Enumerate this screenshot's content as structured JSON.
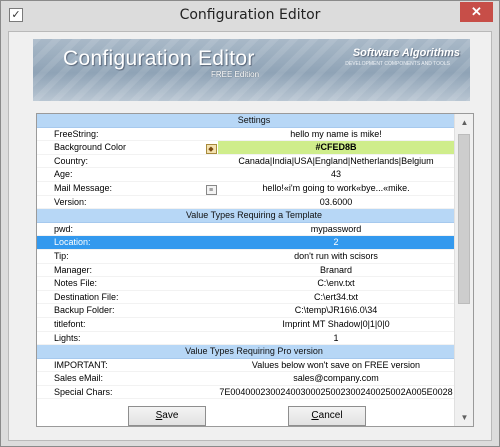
{
  "window": {
    "title": "Configuration Editor",
    "close_glyph": "✕",
    "app_icon": "check-icon"
  },
  "banner": {
    "title": "Configuration Editor",
    "edition": "FREE Edition",
    "brand": "Software Algorithms",
    "tagline": "DEVELOPMENT COMPONENTS AND TOOLS"
  },
  "grid": {
    "rows": [
      {
        "type": "header",
        "label": "Settings"
      },
      {
        "type": "item",
        "key": "FreeString:",
        "value": "hello my name is mike!"
      },
      {
        "type": "item",
        "key": "Background Color",
        "value": "#CFED8B",
        "button": "palette-icon",
        "color": "#cfed8b"
      },
      {
        "type": "item",
        "key": "Country:",
        "value": "Canada|India|USA|England|Netherlands|Belgium"
      },
      {
        "type": "item",
        "key": "Age:",
        "value": "43"
      },
      {
        "type": "item",
        "key": "Mail Message:",
        "value": "hello!«i'm going to work«bye...«mike.",
        "button": "note-icon"
      },
      {
        "type": "item",
        "key": "Version:",
        "value": "03.6000"
      },
      {
        "type": "header",
        "label": "Value Types Requiring a Template"
      },
      {
        "type": "item",
        "key": "pwd:",
        "value": "mypassword"
      },
      {
        "type": "item",
        "key": "Location:",
        "value": "2",
        "selected": true
      },
      {
        "type": "item",
        "key": "Tip:",
        "value": "don't run with scisors"
      },
      {
        "type": "item",
        "key": "Manager:",
        "value": "Branard"
      },
      {
        "type": "item",
        "key": "Notes File:",
        "value": "C:\\env.txt"
      },
      {
        "type": "item",
        "key": "Destination File:",
        "value": "C:\\ert34.txt"
      },
      {
        "type": "item",
        "key": "Backup Folder:",
        "value": "C:\\temp\\JR16\\6.0\\34"
      },
      {
        "type": "item",
        "key": "titlefont:",
        "value": "Imprint MT Shadow|0|1|0|0"
      },
      {
        "type": "item",
        "key": "Lights:",
        "value": "1"
      },
      {
        "type": "header",
        "label": "Value Types Requiring Pro version"
      },
      {
        "type": "item",
        "key": "IMPORTANT:",
        "value": "Values below won't save on FREE version"
      },
      {
        "type": "item",
        "key": "Sales eMail:",
        "value": "sales@company.com"
      },
      {
        "type": "item",
        "key": "Special Chars:",
        "value": "7E00400023002400300025002300240025002A005E0028"
      }
    ]
  },
  "scrollbar": {
    "up_glyph": "▲",
    "down_glyph": "▼",
    "position_fraction": 0.0
  },
  "buttons": {
    "save_mnemonic": "S",
    "save_rest": "ave",
    "cancel_mnemonic": "C",
    "cancel_rest": "ancel"
  }
}
